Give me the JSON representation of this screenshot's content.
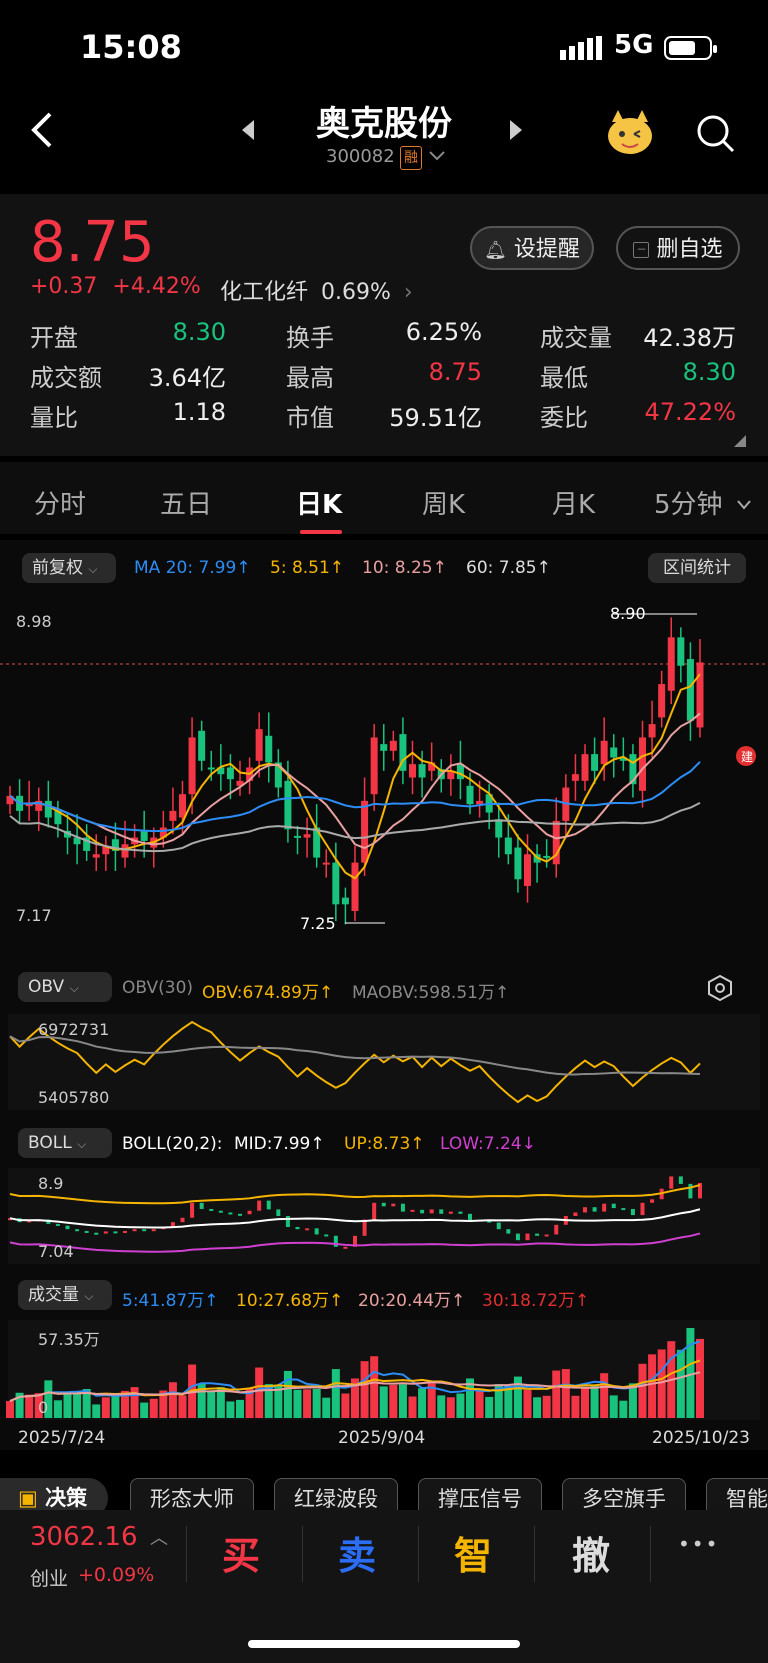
{
  "status": {
    "time": "15:08",
    "network": "5G"
  },
  "header": {
    "title": "奥克股份",
    "code": "300082",
    "badge": "融"
  },
  "quote": {
    "price": "8.75",
    "change": "+0.37",
    "change_pct": "+4.42%",
    "sector_name": "化工化纤",
    "sector_pct": "0.69%",
    "alert_label": "设提醒",
    "watch_label": "删自选"
  },
  "stats": [
    [
      {
        "label": "开盘",
        "value": "8.30",
        "color": "green"
      },
      {
        "label": "换手",
        "value": "6.25%",
        "color": "white"
      },
      {
        "label": "成交量",
        "value": "42.38万",
        "color": "white"
      }
    ],
    [
      {
        "label": "成交额",
        "value": "3.64亿",
        "color": "white"
      },
      {
        "label": "最高",
        "value": "8.75",
        "color": "red"
      },
      {
        "label": "最低",
        "value": "8.30",
        "color": "green"
      }
    ],
    [
      {
        "label": "量比",
        "value": "1.18",
        "color": "white"
      },
      {
        "label": "市值",
        "value": "59.51亿",
        "color": "white"
      },
      {
        "label": "委比",
        "value": "47.22%",
        "color": "red"
      }
    ]
  ],
  "tabs": [
    "分时",
    "五日",
    "日K",
    "周K",
    "月K",
    "5分钟"
  ],
  "active_tab": "日K",
  "kchart": {
    "adjust": "前复权",
    "ma20": "MA 20: 7.99↑",
    "ma5": "5: 8.51↑",
    "ma10": "10: 8.25↑",
    "ma60": "60: 7.85↑",
    "range_stats": "区间统计",
    "y_top": "8.98",
    "y_bottom": "7.17",
    "high_mark": "8.90",
    "low_mark": "7.25",
    "tag": "建"
  },
  "obv": {
    "name": "OBV",
    "param": "OBV(30)",
    "value": "OBV:674.89万↑",
    "ma": "MAOBV:598.51万↑",
    "y_top": "6972731",
    "y_bottom": "5405780"
  },
  "boll": {
    "name": "BOLL",
    "param": "BOLL(20,2):",
    "mid": "MID:7.99↑",
    "up": "UP:8.73↑",
    "low": "LOW:7.24↓",
    "y_top": "8.9",
    "y_bottom": "7.04"
  },
  "vol": {
    "name": "成交量",
    "v5": "5:41.87万↑",
    "v10": "10:27.68万↑",
    "v20": "20:20.44万↑",
    "v30": "30:18.72万↑",
    "y_top": "57.35万",
    "y_bottom": "0"
  },
  "dates": [
    "2025/7/24",
    "2025/9/04",
    "2025/10/23"
  ],
  "toolbar": {
    "decision": "决策",
    "items": [
      "形态大师",
      "红绿波段",
      "撑压信号",
      "多空旗手",
      "智能"
    ]
  },
  "bottom": {
    "index_value": "3062.16",
    "index_name": "创业",
    "index_pct": "+0.09%",
    "buy": "买",
    "sell": "卖",
    "smart": "智",
    "cancel": "撤",
    "more": "•••"
  },
  "colors": {
    "up": "#f23645",
    "down": "#19c37d",
    "ma5": "#f5b400",
    "ma10": "#e8a0a0",
    "ma20": "#2b8df5",
    "ma60": "#aaaaaa",
    "boll_low": "#d040d0"
  },
  "chart_data": {
    "type": "candlestick",
    "closes": [
      7.95,
      7.86,
      7.9,
      7.92,
      7.82,
      7.78,
      7.7,
      7.66,
      7.62,
      7.6,
      7.65,
      7.62,
      7.66,
      7.7,
      7.68,
      7.7,
      7.76,
      7.86,
      7.96,
      8.3,
      8.16,
      8.12,
      8.08,
      8.05,
      8.04,
      8.12,
      8.35,
      8.15,
      8.0,
      7.75,
      7.7,
      7.72,
      7.58,
      7.55,
      7.3,
      7.3,
      7.55,
      7.92,
      8.3,
      8.22,
      8.28,
      8.1,
      8.14,
      8.06,
      8.15,
      8.05,
      8.1,
      8.05,
      7.9,
      7.92,
      7.85,
      7.7,
      7.6,
      7.45,
      7.6,
      7.55,
      7.58,
      7.8,
      8.0,
      8.08,
      8.2,
      8.1,
      8.28,
      8.18,
      8.16,
      8.02,
      8.3,
      8.38,
      8.62,
      8.9,
      8.73,
      8.4,
      8.75
    ]
  }
}
